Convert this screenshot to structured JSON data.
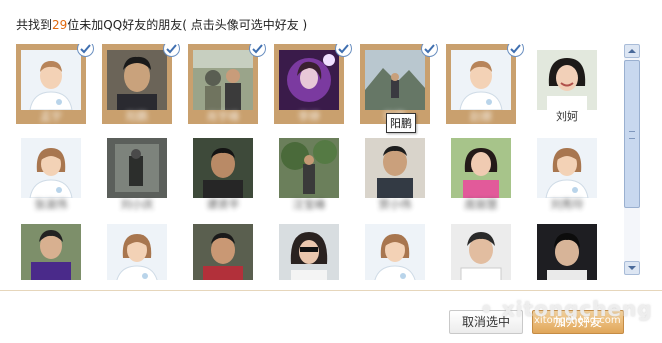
{
  "header": {
    "prefix": "共找到",
    "count": "29",
    "suffix": "位未加QQ好友的朋友",
    "hint": "( 点击头像可选中好友 )"
  },
  "tooltip": "阳鹏",
  "buttons": {
    "cancel": "取消选中",
    "add": "加为好友"
  },
  "watermark": {
    "main": "• xitongcheng",
    "sub": "xitongcheng.com"
  },
  "colors": {
    "selected_bg": "#c9a06e",
    "count_color": "#e06a10",
    "accent_blue": "#6a8fc0"
  },
  "friends": [
    {
      "name": "孟宇",
      "selected": true,
      "avatar": "default-avatar-male",
      "blurred": true
    },
    {
      "name": "阳鹏",
      "selected": true,
      "avatar": "photo-man-portrait",
      "blurred": true
    },
    {
      "name": "肖宇峰",
      "selected": true,
      "avatar": "photo-group-outdoor",
      "blurred": true
    },
    {
      "name": "李婷",
      "selected": true,
      "avatar": "photo-purple-girl",
      "blurred": true
    },
    {
      "name": "阳鹏",
      "selected": true,
      "avatar": "photo-mountain-person",
      "blurred": true
    },
    {
      "name": "赵娜",
      "selected": true,
      "avatar": "default-avatar-male",
      "blurred": true
    },
    {
      "name": "刘妸",
      "selected": false,
      "avatar": "photo-girl-smile",
      "blurred": false
    },
    {
      "name": "张淑伟",
      "selected": false,
      "avatar": "default-avatar-female",
      "blurred": true
    },
    {
      "name": "刘小庆",
      "selected": false,
      "avatar": "photo-dark-scene",
      "blurred": true
    },
    {
      "name": "谭贤平",
      "selected": false,
      "avatar": "photo-man-dark",
      "blurred": true
    },
    {
      "name": "汪宝峰",
      "selected": false,
      "avatar": "photo-tree-outdoor",
      "blurred": true
    },
    {
      "name": "贺小伟",
      "selected": false,
      "avatar": "photo-man-casual",
      "blurred": true
    },
    {
      "name": "庞丽慧",
      "selected": false,
      "avatar": "photo-girl-pink",
      "blurred": true
    },
    {
      "name": "刘秀玲",
      "selected": false,
      "avatar": "default-avatar-female",
      "blurred": true
    },
    {
      "name": "",
      "selected": false,
      "avatar": "photo-purple-shirt",
      "blurred": false
    },
    {
      "name": "",
      "selected": false,
      "avatar": "default-avatar-female",
      "blurred": false
    },
    {
      "name": "",
      "selected": false,
      "avatar": "photo-man-red",
      "blurred": false
    },
    {
      "name": "",
      "selected": false,
      "avatar": "photo-girl-sunglasses",
      "blurred": false
    },
    {
      "name": "",
      "selected": false,
      "avatar": "default-avatar-female",
      "blurred": false
    },
    {
      "name": "",
      "selected": false,
      "avatar": "photo-boy-white",
      "blurred": false
    },
    {
      "name": "",
      "selected": false,
      "avatar": "photo-boy-dark",
      "blurred": false
    }
  ]
}
